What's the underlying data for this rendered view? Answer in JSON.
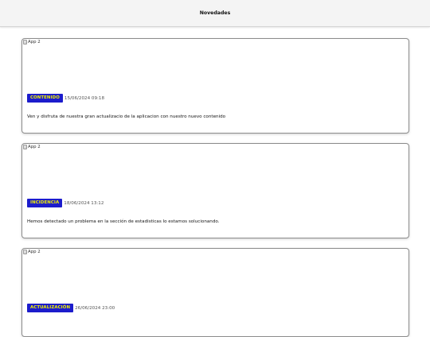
{
  "header": {
    "title": "Novedades"
  },
  "news": [
    {
      "image_alt": "App 2",
      "category": "CONTENIDO",
      "date": "15/06/2024 09:18",
      "text": "Ven y disfruta de nuestra gran actualizacio de la aplicacion con nuestro nuevo contenido"
    },
    {
      "image_alt": "App 2",
      "category": "INCIDENCIA",
      "date": "18/06/2024 13:12",
      "text": "Hemos detectado un problema en la sección de estadisticas lo estamos solucionando."
    },
    {
      "image_alt": "App 2",
      "category": "ACTUALIZACIÓN",
      "date": "26/06/2024 23:00",
      "text": ""
    }
  ],
  "colors": {
    "badge_bg": "#1c1ccc",
    "badge_text": "#f0f000",
    "topbar_bg": "#f4f4f4"
  }
}
